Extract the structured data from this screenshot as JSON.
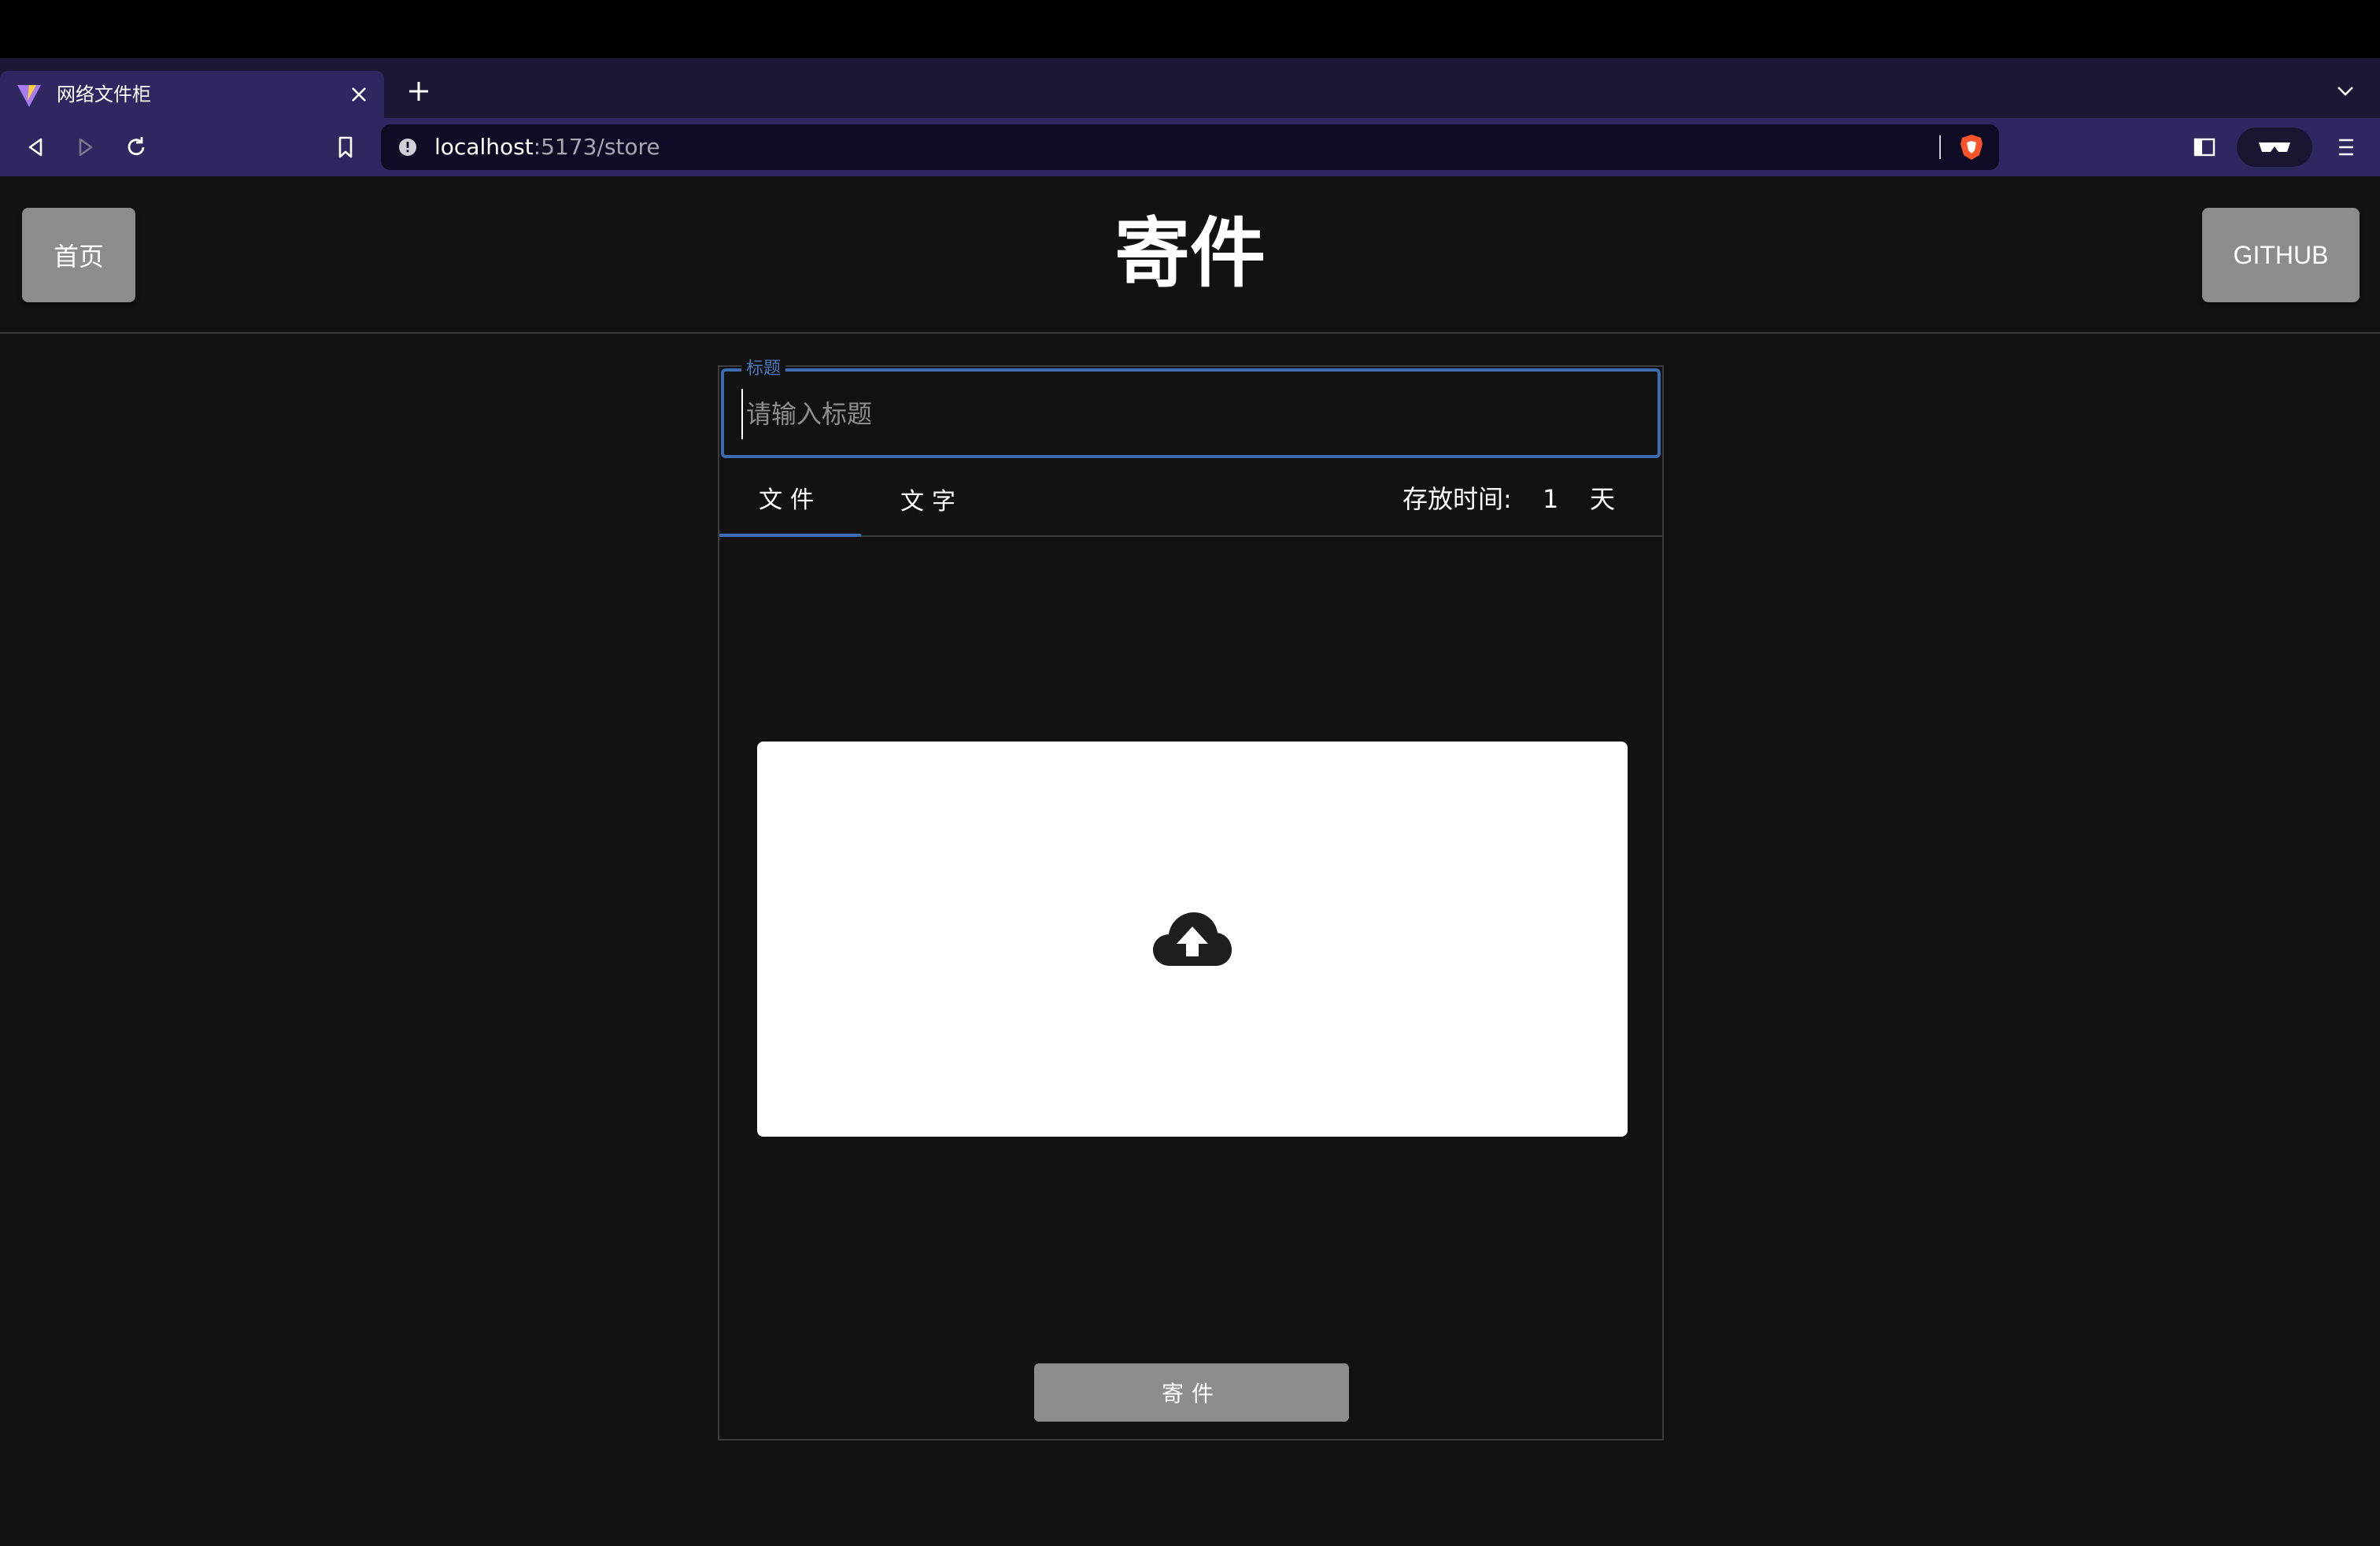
{
  "browser": {
    "tab_title": "网络文件柜",
    "url_host": "localhost",
    "url_path": ":5173/store",
    "icons": {
      "favicon": "vite-logo-icon",
      "close": "close-icon",
      "new_tab": "plus-icon",
      "tab_menu": "chevron-down-icon",
      "back": "back-icon",
      "forward": "forward-icon",
      "reload": "reload-icon",
      "bookmark": "bookmark-icon",
      "site_info": "info-icon",
      "shields": "brave-shield-icon",
      "sidebar": "sidebar-icon",
      "vpn": "vpn-glasses-icon",
      "menu": "hamburger-menu-icon"
    },
    "colors": {
      "tabstrip": "#1b1734",
      "toolbar": "#2f2760",
      "urlbar": "#0e0b24"
    }
  },
  "header": {
    "home_label": "首页",
    "title": "寄件",
    "github_label": "GITHUB"
  },
  "form": {
    "title_legend": "标题",
    "title_placeholder": "请输入标题",
    "tabs": [
      {
        "label": "文件",
        "active": true
      },
      {
        "label": "文字",
        "active": false
      }
    ],
    "expiry_label": "存放时间:",
    "expiry_value": "1",
    "expiry_unit": "天",
    "upload_icon": "cloud-upload-icon",
    "submit_label": "寄件",
    "accent_color": "#3d6cb0"
  }
}
